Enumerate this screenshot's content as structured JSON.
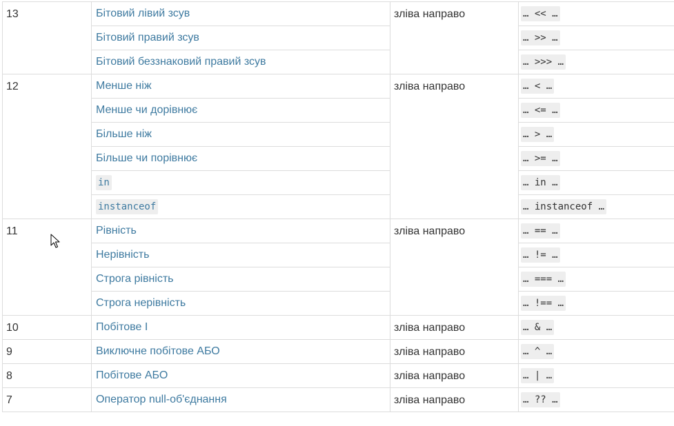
{
  "groups": [
    {
      "precedence": "13",
      "associativity": "зліва направо",
      "rows": [
        {
          "name": "Бітовий лівий зсув",
          "syntax": "… << …"
        },
        {
          "name": "Бітовий правий зсув",
          "syntax": "… >> …"
        },
        {
          "name": "Бітовий беззнаковий правий зсув",
          "syntax": "… >>> …"
        }
      ]
    },
    {
      "precedence": "12",
      "associativity": "зліва направо",
      "rows": [
        {
          "name": "Менше ніж",
          "syntax": "… < …"
        },
        {
          "name": "Менше чи дорівнює",
          "syntax": "… <= …"
        },
        {
          "name": "Більше ніж",
          "syntax": "… > …"
        },
        {
          "name": "Більше чи порівнює",
          "syntax": "… >= …"
        },
        {
          "name": "in",
          "syntax": "… in …",
          "code_name": true
        },
        {
          "name": "instanceof",
          "syntax": "… instanceof …",
          "code_name": true
        }
      ]
    },
    {
      "precedence": "11",
      "associativity": "зліва направо",
      "rows": [
        {
          "name": "Рівність",
          "syntax": "… == …"
        },
        {
          "name": "Нерівність",
          "syntax": "… != …"
        },
        {
          "name": "Строга рівність",
          "syntax": "… === …"
        },
        {
          "name": "Строга нерівність",
          "syntax": "… !== …"
        }
      ]
    },
    {
      "precedence": "10",
      "associativity": "зліва направо",
      "rows": [
        {
          "name": "Побітове І",
          "syntax": "… & …"
        }
      ]
    },
    {
      "precedence": "9",
      "associativity": "зліва направо",
      "rows": [
        {
          "name": "Виключне побітове АБО",
          "syntax": "… ^ …"
        }
      ]
    },
    {
      "precedence": "8",
      "associativity": "зліва направо",
      "rows": [
        {
          "name": "Побітове АБО",
          "syntax": "… | …"
        }
      ]
    },
    {
      "precedence": "7",
      "associativity": "зліва направо",
      "rows": [
        {
          "name": "Оператор null-об'єднання",
          "syntax": "… ?? …"
        }
      ]
    }
  ],
  "colors": {
    "link": "#3e7aa0",
    "text": "#333333",
    "border": "#dcdcdc",
    "code_background": "#eeeeee"
  },
  "icons": {
    "cursor": "mouse-pointer-icon"
  }
}
